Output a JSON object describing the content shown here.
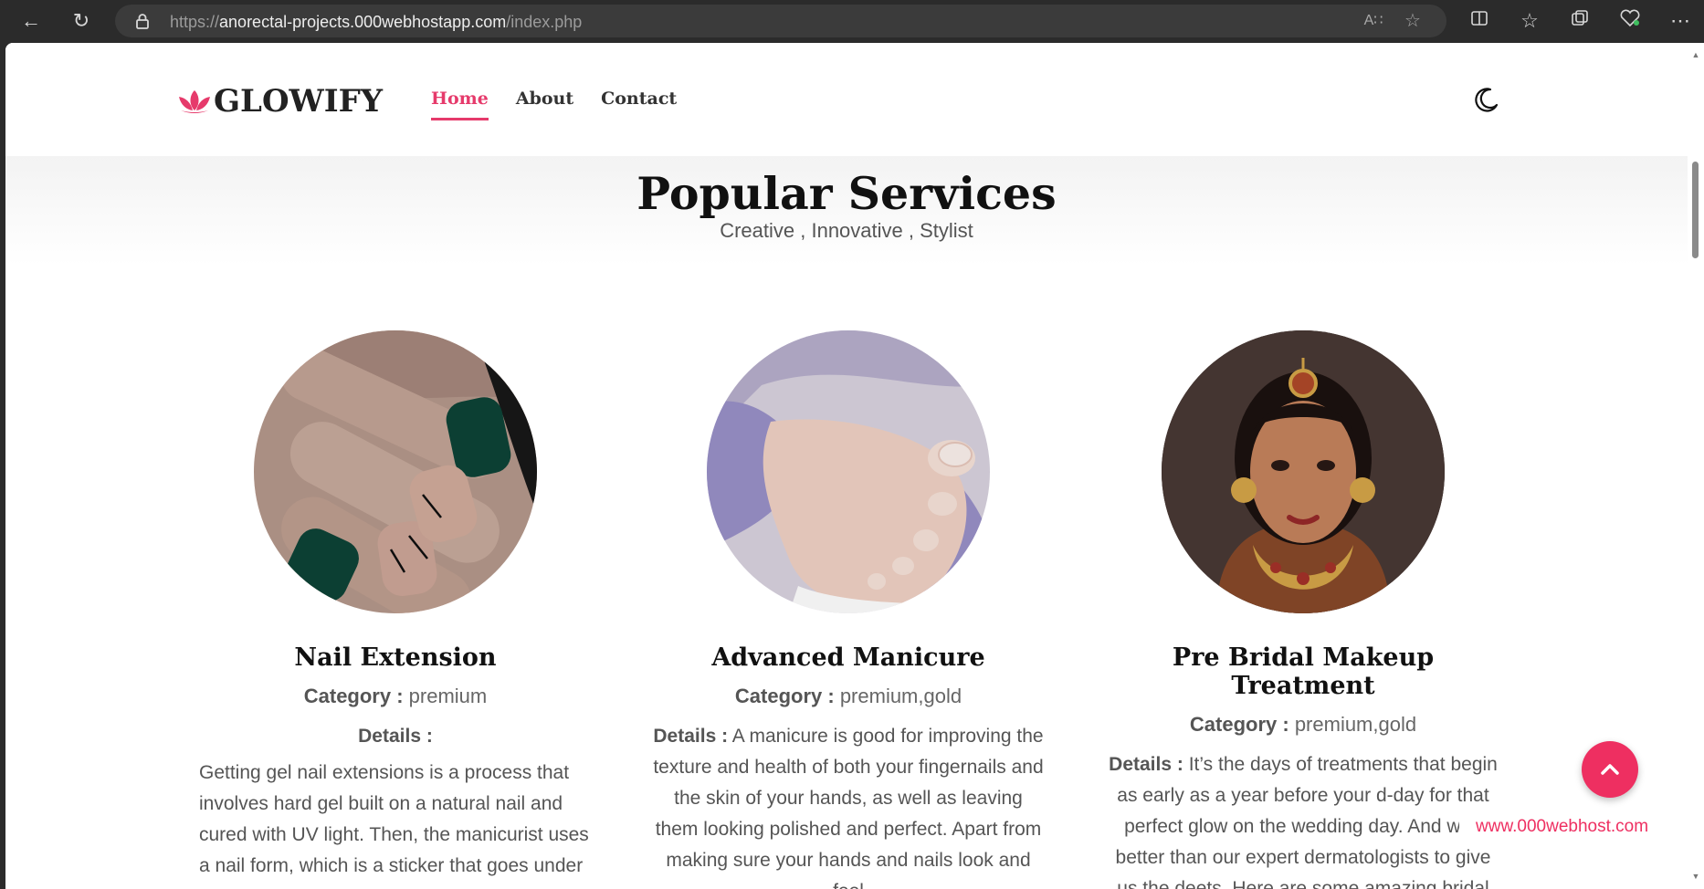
{
  "browser": {
    "url_scheme": "https://",
    "url_host": "anorectal-projects.000webhostapp.com",
    "url_path": "/index.php"
  },
  "site": {
    "brand": "GLOWIFY",
    "nav": [
      {
        "label": "Home",
        "active": true
      },
      {
        "label": "About",
        "active": false
      },
      {
        "label": "Contact",
        "active": false
      }
    ]
  },
  "section": {
    "title": "Popular Services",
    "subtitle": "Creative , Innovative , Stylist"
  },
  "services": [
    {
      "title": "Nail Extension",
      "category_label": "Category :",
      "category": " premium",
      "details_label": "Details :",
      "details": "Getting gel nail extensions is a process that involves hard gel built on a natural nail and cured with UV light. Then, the manicurist uses a nail form, which is a sticker that goes under"
    },
    {
      "title": "Advanced Manicure",
      "category_label": "Category :",
      "category": " premium,gold",
      "details_label": "Details :",
      "details": " A manicure is good for improving the texture and health of both your fingernails and the skin of your hands, as well as leaving them looking polished and perfect. Apart from making sure your hands and nails look and feel"
    },
    {
      "title": "Pre Bridal Makeup Treatment",
      "category_label": "Category :",
      "category": " premium,gold",
      "details_label": "Details :",
      "details": " It’s the days of treatments that begin as early as a year before your d-day for that perfect glow on the wedding day. And who better than our expert dermatologists to give us the deets. Here are some amazing bridal"
    }
  ],
  "footer": {
    "webhost_text": "www.000webhost.com"
  },
  "colors": {
    "accent": "#ee2f61",
    "heading": "#111111",
    "body_text": "#555555"
  }
}
